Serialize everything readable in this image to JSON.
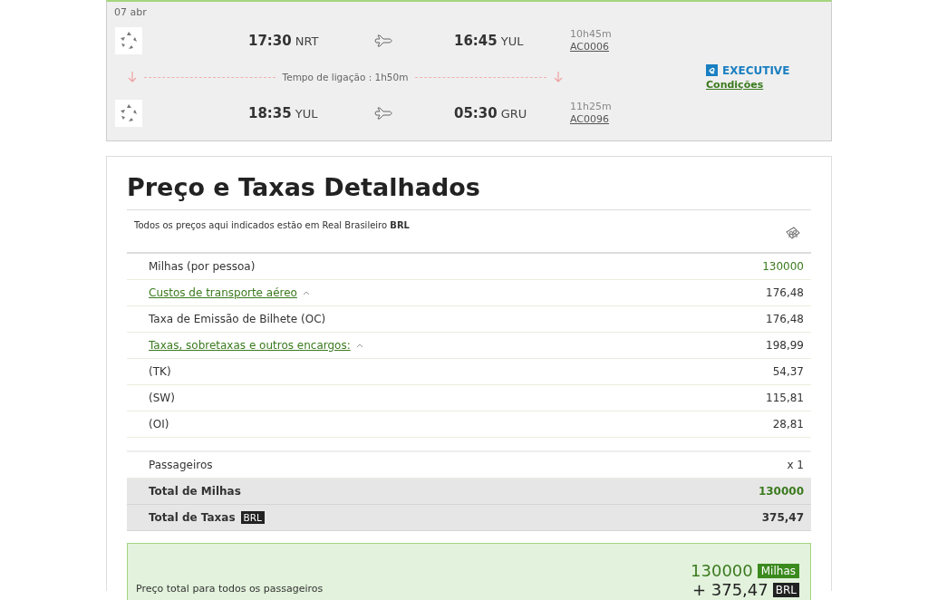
{
  "itinerary": {
    "date": "07 abr",
    "segments": [
      {
        "departure_time": "17:30",
        "departure_airport": "NRT",
        "arrival_time": "16:45",
        "arrival_airport": "YUL",
        "duration": "10h45m",
        "flight_number": "AC0006"
      },
      {
        "departure_time": "18:35",
        "departure_airport": "YUL",
        "arrival_time": "05:30",
        "arrival_airport": "GRU",
        "duration": "11h25m",
        "flight_number": "AC0096"
      }
    ],
    "connection": "Tempo de ligação : 1h50m",
    "cabin": "EXECUTIVE",
    "conditions_link": "Condições"
  },
  "price_details": {
    "title": "Preço e Taxas Detalhados",
    "currency_note": "Todos os preços aqui indicados estão em Real Brasileiro **BRL**",
    "rows": [
      {
        "kind": "plain",
        "label": "Milhas (por pessoa)",
        "value": "130000",
        "miles": true
      },
      {
        "kind": "expand",
        "label": "Custos de transporte aéreo",
        "value": "176,48",
        "expanded": true,
        "miles": false
      },
      {
        "kind": "plain",
        "label": "Taxa de Emissão de Bilhete (OC)",
        "value": "176,48",
        "miles": false
      },
      {
        "kind": "expand",
        "label": "Taxas, sobretaxas e outros encargos:",
        "value": "198,99",
        "expanded": true,
        "miles": false
      },
      {
        "kind": "plain",
        "label": "(TK)",
        "value": "54,37",
        "miles": false
      },
      {
        "kind": "plain",
        "label": "(SW)",
        "value": "115,81",
        "miles": false
      },
      {
        "kind": "plain",
        "label": "(OI)",
        "value": "28,81",
        "miles": false
      },
      {
        "kind": "blank"
      },
      {
        "kind": "plain",
        "label": "Passageiros",
        "value": "x 1",
        "miles": false
      },
      {
        "kind": "total",
        "label": "Total de Milhas",
        "value": "130000",
        "miles": true
      },
      {
        "kind": "total",
        "label": "Total de Taxas",
        "badge": "BRL",
        "value": "375,47",
        "miles": false
      }
    ],
    "total": {
      "label": "Preço total para todos os passageiros",
      "miles": "130000",
      "miles_unit": "Milhas",
      "taxes": "+ 375,47",
      "taxes_unit": "BRL"
    }
  }
}
